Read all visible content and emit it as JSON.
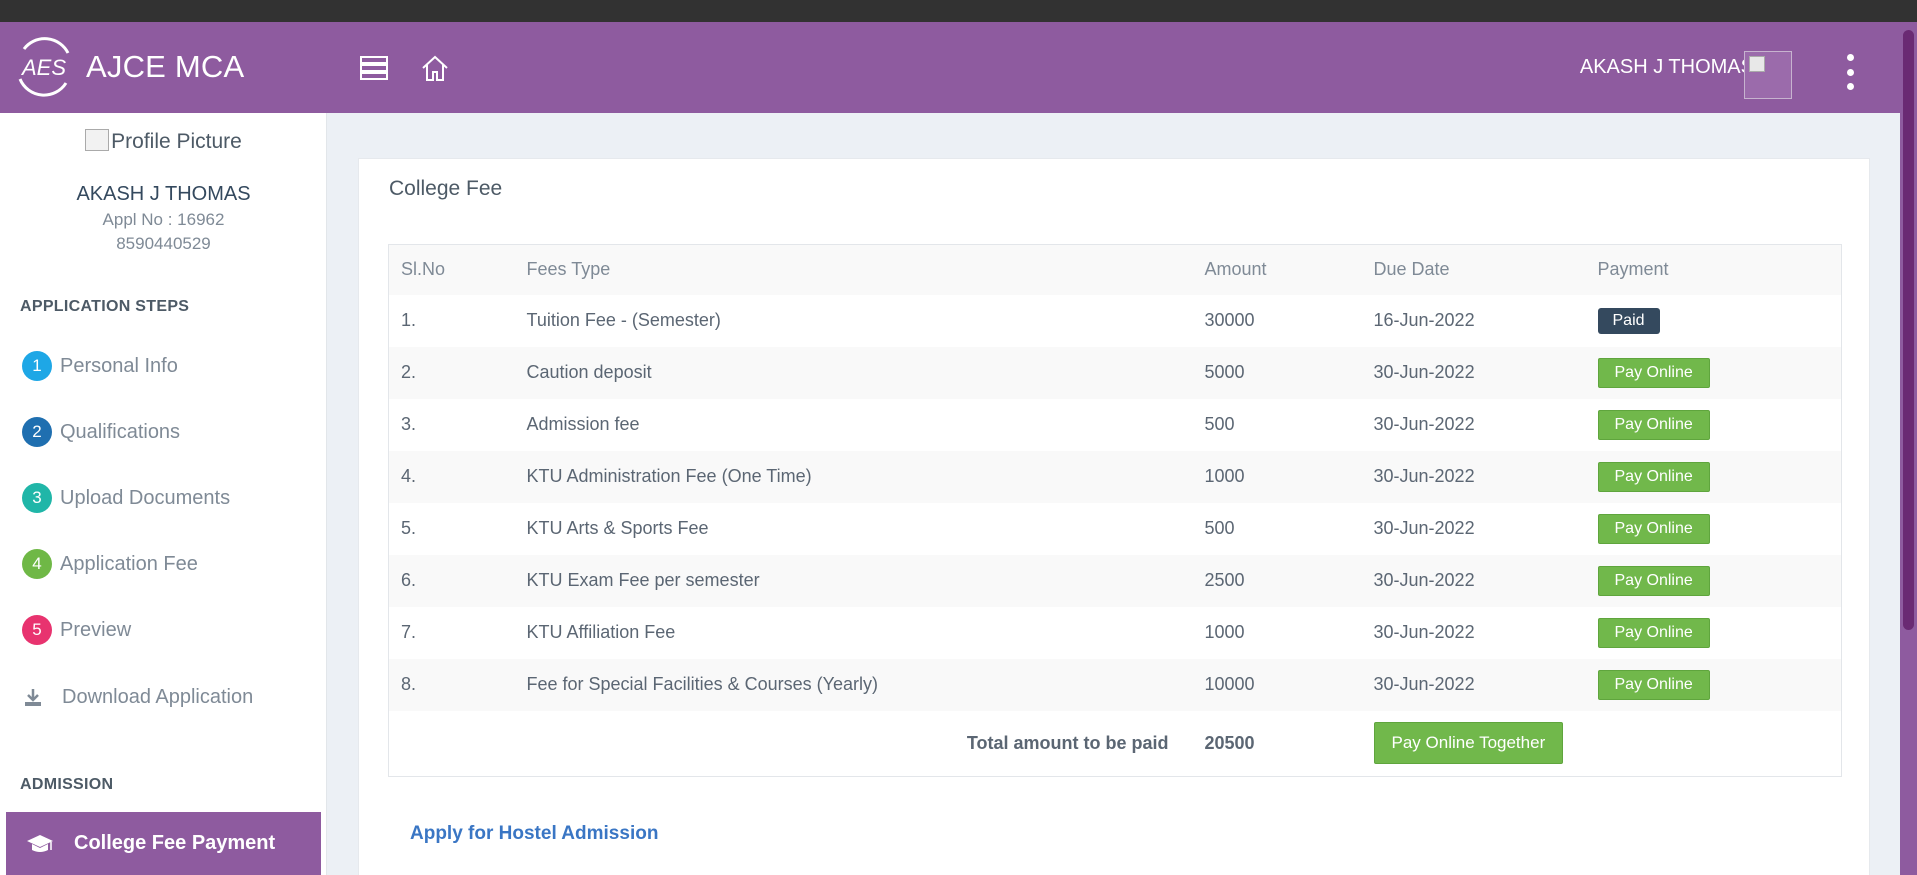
{
  "app": {
    "name": "AJCE MCA",
    "logo_text": "AES",
    "user_name": "AKASH J THOMAS"
  },
  "colors": {
    "brand": "#8e5b9f",
    "paid": "#34495e",
    "pay_online": "#71b84b",
    "link": "#3a76c4"
  },
  "sidebar": {
    "profile_picture_alt": "Profile Picture",
    "name": "AKASH J THOMAS",
    "appl_no": "Appl No : 16962",
    "phone": "8590440529",
    "steps_header": "APPLICATION STEPS",
    "steps": [
      {
        "num": "1",
        "label": "Personal Info",
        "color": "#1ea7e6"
      },
      {
        "num": "2",
        "label": "Qualifications",
        "color": "#1f6fb0"
      },
      {
        "num": "3",
        "label": "Upload Documents",
        "color": "#20b6a8"
      },
      {
        "num": "4",
        "label": "Application Fee",
        "color": "#6fb846"
      },
      {
        "num": "5",
        "label": "Preview",
        "color": "#e8336f"
      }
    ],
    "download_label": "Download Application",
    "download_icon": "download-icon",
    "admission_header": "ADMISSION",
    "active_item": {
      "label": "College Fee Payment",
      "icon": "graduation-cap-icon"
    }
  },
  "main": {
    "card_title": "College Fee",
    "table": {
      "headers": [
        "Sl.No",
        "Fees Type",
        "Amount",
        "Due Date",
        "Payment"
      ],
      "rows": [
        {
          "sl": "1.",
          "type": "Tuition Fee - (Semester)",
          "amount": "30000",
          "due": "16-Jun-2022",
          "payment": "Paid",
          "status": "paid"
        },
        {
          "sl": "2.",
          "type": "Caution deposit",
          "amount": "5000",
          "due": "30-Jun-2022",
          "payment": "Pay Online",
          "status": "pay"
        },
        {
          "sl": "3.",
          "type": "Admission fee",
          "amount": "500",
          "due": "30-Jun-2022",
          "payment": "Pay Online",
          "status": "pay"
        },
        {
          "sl": "4.",
          "type": "KTU Administration Fee (One Time)",
          "amount": "1000",
          "due": "30-Jun-2022",
          "payment": "Pay Online",
          "status": "pay"
        },
        {
          "sl": "5.",
          "type": "KTU Arts & Sports Fee",
          "amount": "500",
          "due": "30-Jun-2022",
          "payment": "Pay Online",
          "status": "pay"
        },
        {
          "sl": "6.",
          "type": "KTU Exam Fee per semester",
          "amount": "2500",
          "due": "30-Jun-2022",
          "payment": "Pay Online",
          "status": "pay"
        },
        {
          "sl": "7.",
          "type": "KTU Affiliation Fee",
          "amount": "1000",
          "due": "30-Jun-2022",
          "payment": "Pay Online",
          "status": "pay"
        },
        {
          "sl": "8.",
          "type": "Fee for Special Facilities & Courses (Yearly)",
          "amount": "10000",
          "due": "30-Jun-2022",
          "payment": "Pay Online",
          "status": "pay"
        }
      ],
      "total_label": "Total amount to be paid",
      "total_value": "20500",
      "pay_together_label": "Pay Online Together"
    },
    "hostel_link": "Apply for Hostel Admission"
  }
}
